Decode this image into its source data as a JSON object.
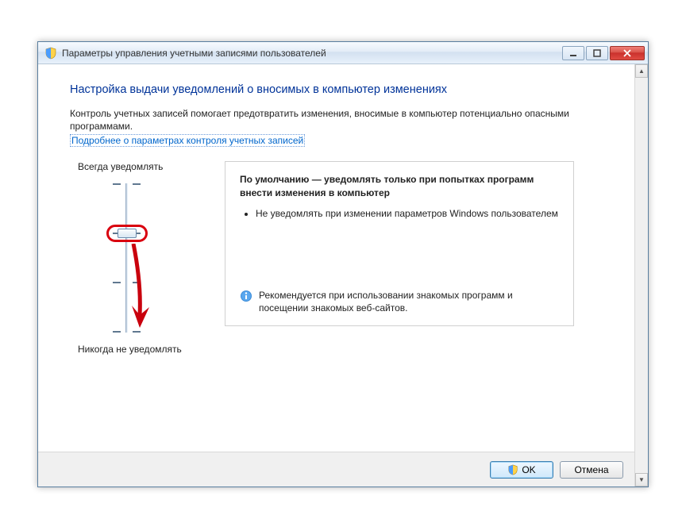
{
  "window": {
    "title": "Параметры управления учетными записями пользователей"
  },
  "page": {
    "heading": "Настройка выдачи уведомлений о вносимых в компьютер изменениях",
    "intro": "Контроль учетных записей помогает предотвратить изменения, вносимые в компьютер потенциально опасными программами.",
    "learn_more": "Подробнее о параметрах контроля учетных записей"
  },
  "slider": {
    "label_always": "Всегда уведомлять",
    "label_never": "Никогда не уведомлять",
    "levels": 4,
    "current_level": 2
  },
  "description": {
    "title": "По умолчанию — уведомлять только при попытках программ внести изменения в компьютер",
    "bullets": [
      "Не уведомлять при изменении параметров Windows пользователем"
    ],
    "recommendation": "Рекомендуется при использовании знакомых программ и посещении знакомых веб-сайтов."
  },
  "buttons": {
    "ok": "OK",
    "cancel": "Отмена"
  }
}
